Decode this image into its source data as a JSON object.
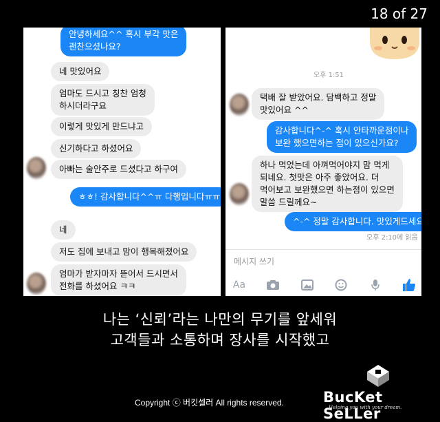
{
  "slide_counter": "18 of 27",
  "left_chat": {
    "messages": [
      {
        "dir": "out",
        "text": "안녕하세요^^ 혹시 부각 맛은\n괜찬으셨나요?"
      },
      {
        "dir": "in",
        "text": "네 맛있어요"
      },
      {
        "dir": "in",
        "text": "엄마도 드시고 칭찬 엄청\n하시더라구요"
      },
      {
        "dir": "in",
        "text": "이렇게 맛있게 만드냐고"
      },
      {
        "dir": "in",
        "text": "신기하다고 하셨어요"
      },
      {
        "dir": "in",
        "text": "아빠는 술안주로 드셨다고 하구여"
      },
      {
        "dir": "out",
        "text": "ㅎㅎ! 감사합니다^^ㅠ 다행입니다ㅠㅠ"
      },
      {
        "dir": "in",
        "text": "네"
      },
      {
        "dir": "in",
        "text": "저도 집에 보내고 맘이 행복해졌어요"
      },
      {
        "dir": "in",
        "text": "엄마가 받자마자 뜯어서 드시면서\n전화를 하셨어요 ㅋㅋ"
      }
    ]
  },
  "right_chat": {
    "time_label": "오후 1:51",
    "messages": [
      {
        "dir": "in",
        "text": "택배 잘 받았어요. 담백하고 정말\n맛있어요 ^^"
      },
      {
        "dir": "out",
        "text": "감사합니다^-^ 혹시 안타까운점이나\n보완 했으면하는 점이 있으신가요?"
      },
      {
        "dir": "in",
        "text": "하나 먹었는데 아껴먹어야지 맘 먹게\n되네요. 첫맛은 아주 좋았어요. 더\n먹어보고 보완했으면 하는점이 있으면\n말씀 드릴께요~"
      },
      {
        "dir": "out",
        "text": "^-^ 정말 감사합니다. 맛있게드세요!"
      }
    ],
    "read_receipt": "오후 2:10에 읽음",
    "composer_placeholder": "메시지 쓰기",
    "composer_text_icon": "Aa"
  },
  "caption_line1": "나는 ‘신뢰’라는 나만의 무기를 앞세워",
  "caption_line2": "고객들과 소통하며 장사를 시작했고",
  "footer_copyright": "Copyright ⓒ 버킷셀러 All rights reserved.",
  "logo_name": "BucKet SeLLer",
  "logo_tagline": "Helping you with your dream.",
  "colors": {
    "accent": "#1b86f5",
    "incoming": "#ececec",
    "background": "#000000"
  }
}
